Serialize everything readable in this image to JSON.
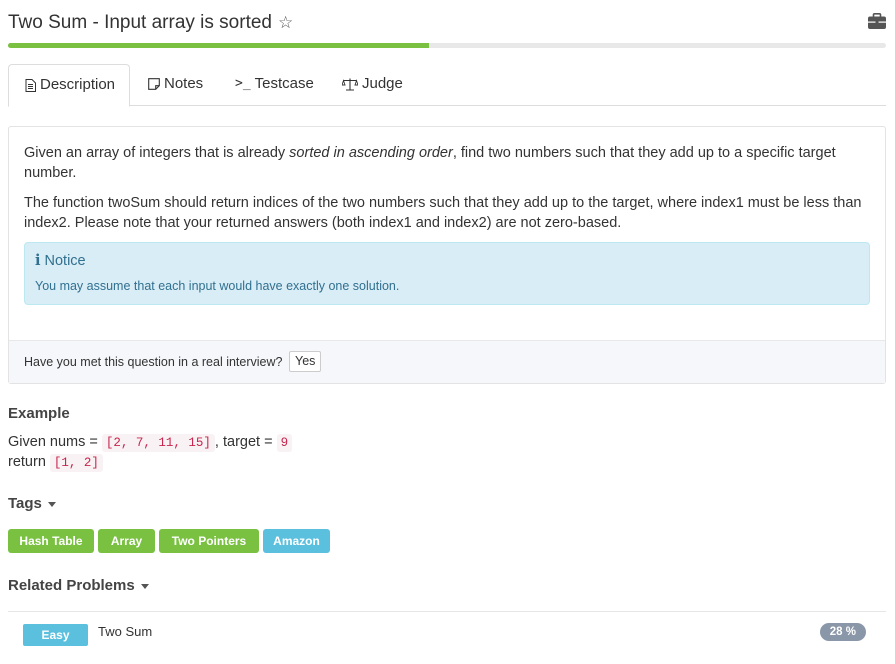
{
  "header": {
    "title": "Two Sum - Input array is sorted",
    "star_icon": "star-outline-icon",
    "briefcase_icon": "briefcase-icon"
  },
  "progress": {
    "fraction": 0.48,
    "color": "#7ac142"
  },
  "tabs": [
    {
      "label": "Description",
      "icon": "document-icon",
      "active": true
    },
    {
      "label": "Notes",
      "icon": "note-icon",
      "active": false
    },
    {
      "label": "Testcase",
      "icon": "terminal-icon",
      "active": false
    },
    {
      "label": "Judge",
      "icon": "scale-icon",
      "active": false
    }
  ],
  "description": {
    "p1_before": "Given an array of integers that is already ",
    "p1_em": "sorted in ascending order",
    "p1_after": ", find two numbers such that they add up to a specific target number.",
    "p2": "The function twoSum should return indices of the two numbers such that they add up to the target, where index1 must be less than index2. Please note that your returned answers (both index1 and index2) are not zero-based.",
    "notice_title": "Notice",
    "notice_icon": "info-icon",
    "notice_text": "You may assume that each input would have exactly one solution.",
    "interview_question": "Have you met this question in a real interview?",
    "yes_label": "Yes"
  },
  "example": {
    "heading": "Example",
    "line1_prefix": "Given nums = ",
    "nums": "[2, 7, 11, 15]",
    "line1_mid": ", target = ",
    "target": "9",
    "line2_prefix": "return ",
    "result": "[1, 2]"
  },
  "tags": {
    "heading": "Tags",
    "items": [
      {
        "label": "Hash Table",
        "color": "#7ac142"
      },
      {
        "label": "Array",
        "color": "#7ac142"
      },
      {
        "label": "Two Pointers",
        "color": "#7ac142"
      },
      {
        "label": "Amazon",
        "color": "#5bc0de"
      }
    ]
  },
  "related": {
    "heading": "Related Problems",
    "items": [
      {
        "difficulty": "Easy",
        "name": "Two Sum",
        "percent": "28 %"
      }
    ]
  }
}
